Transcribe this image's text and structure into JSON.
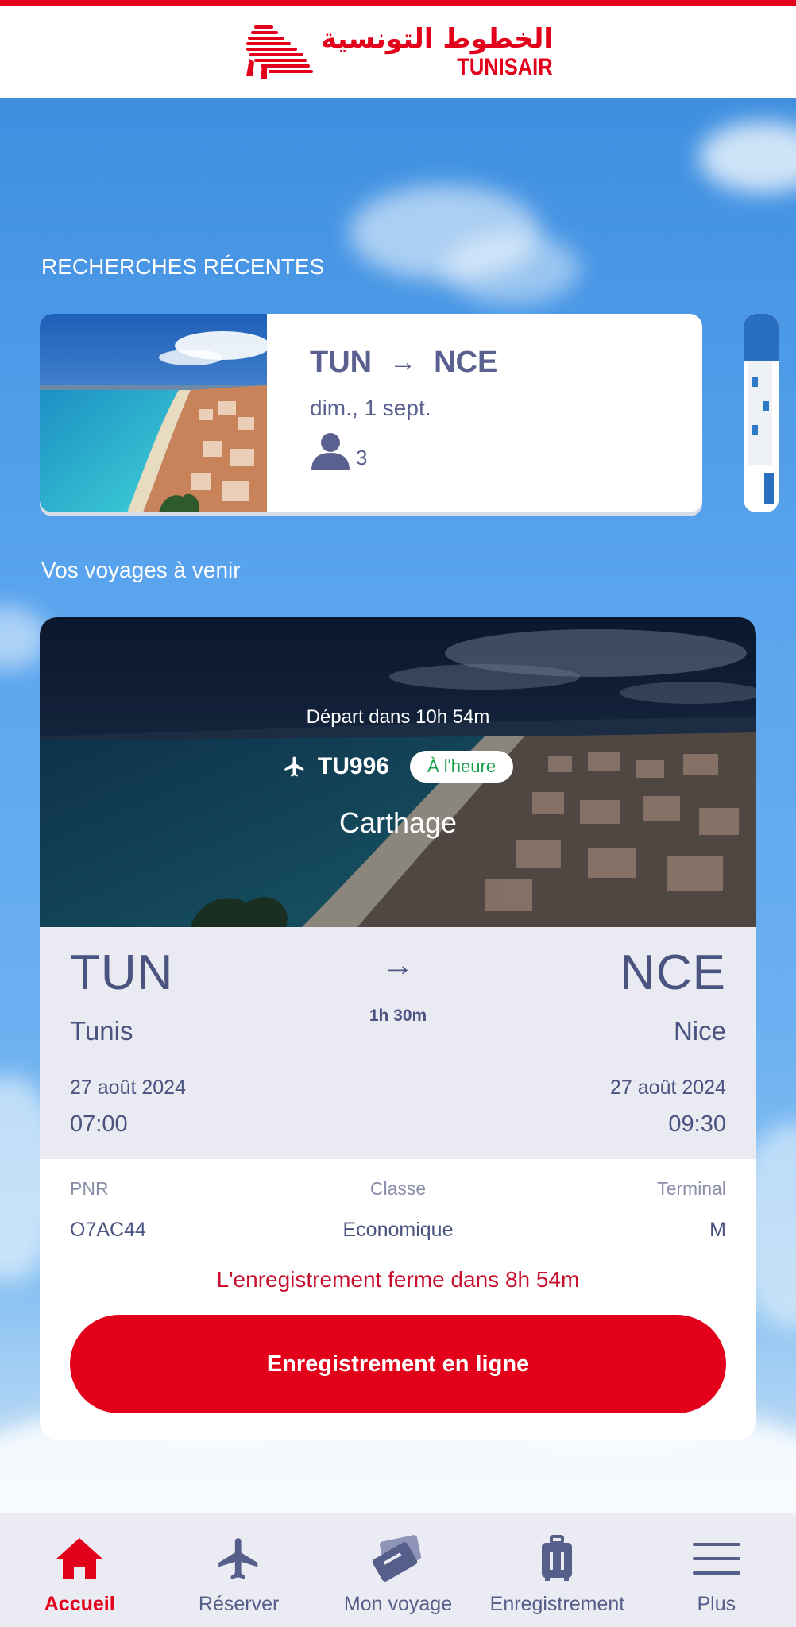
{
  "colors": {
    "brand_red": "#e2001a",
    "navy_text": "#5a6190",
    "status_green": "#1aa04a",
    "nav_background": "#eaebf3",
    "details_background": "#e9eaf2"
  },
  "header": {
    "logo_arabic": "الخطوط التونسية",
    "logo_latin": "TUNISAIR"
  },
  "recent_searches": {
    "title": "RECHERCHES RÉCENTES",
    "items": [
      {
        "origin": "TUN",
        "arrow": "→",
        "destination": "NCE",
        "date": "dim., 1 sept.",
        "passengers": "3",
        "icon": "person-icon"
      }
    ]
  },
  "upcoming": {
    "title": "Vos voyages à venir",
    "trip": {
      "departure_countdown": "Départ dans 10h 54m",
      "flight_number": "TU996",
      "flight_icon": "airplane-icon",
      "status": "À l'heure",
      "airport_name": "Carthage",
      "origin_code": "TUN",
      "origin_city": "Tunis",
      "destination_code": "NCE",
      "destination_city": "Nice",
      "arrow": "→",
      "duration": "1h 30m",
      "departure_date": "27 août 2024",
      "departure_time": "07:00",
      "arrival_date": "27 août 2024",
      "arrival_time": "09:30",
      "pnr_label": "PNR",
      "pnr_value": "O7AC44",
      "class_label": "Classe",
      "class_value": "Economique",
      "terminal_label": "Terminal",
      "terminal_value": "M",
      "checkin_closing": "L'enregistrement ferme dans 8h 54m",
      "checkin_button": "Enregistrement en ligne"
    }
  },
  "bottom_nav": {
    "items": [
      {
        "label": "Accueil",
        "icon": "home-icon",
        "active": true
      },
      {
        "label": "Réserver",
        "icon": "airplane-icon",
        "active": false
      },
      {
        "label": "Mon voyage",
        "icon": "ticket-icon",
        "active": false
      },
      {
        "label": "Enregistrement",
        "icon": "luggage-icon",
        "active": false
      },
      {
        "label": "Plus",
        "icon": "menu-icon",
        "active": false
      }
    ]
  }
}
